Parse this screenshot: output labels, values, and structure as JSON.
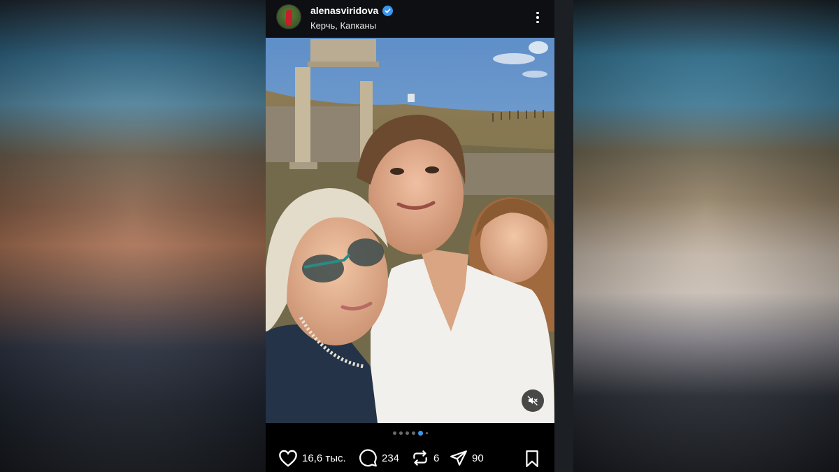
{
  "post": {
    "username": "alenasviridova",
    "location": "Керчь, Капканы",
    "verified": true,
    "carousel": {
      "count": 6,
      "active_index": 4
    },
    "actions": {
      "likes": "16,6 тыс.",
      "comments": "234",
      "reposts": "6",
      "shares": "90"
    }
  },
  "icons": {
    "verified": "verified-badge-icon",
    "more": "more-options-icon",
    "mute": "speaker-muted-icon",
    "like": "heart-icon",
    "comment": "comment-bubble-icon",
    "repost": "repost-icon",
    "share": "paper-plane-icon",
    "save": "bookmark-icon"
  },
  "colors": {
    "accent": "#3897f0",
    "background": "#000000",
    "text": "#ffffff"
  }
}
